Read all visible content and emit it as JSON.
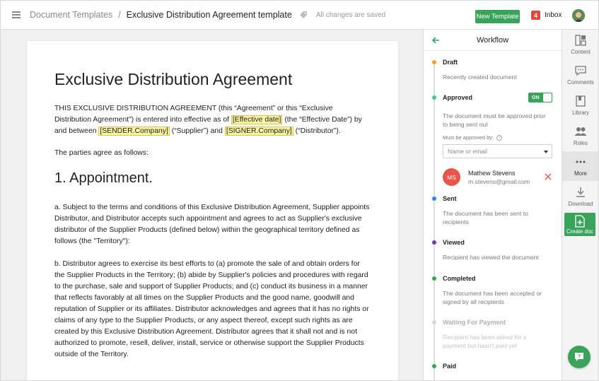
{
  "header": {
    "breadcrumb_root": "Document Templates",
    "breadcrumb_sep": "/",
    "document_name": "Exclusive Distribution Agreement template",
    "save_status": "All changes are saved",
    "new_template_label": "New Template",
    "inbox_count": "4",
    "inbox_label": "Inbox"
  },
  "document": {
    "title": "Exclusive Distribution Agreement",
    "intro": {
      "t1": "THIS EXCLUSIVE DISTRIBUTION AGREEMENT (this “Agreement” or this “Exclusive Distribution Agreement”) is entered into effective as of ",
      "f1": "[Effective date]",
      "t2": " (the “Effective Date”) by and between ",
      "f2": "[SENDER.Company]",
      "t3": " (“Supplier”) and ",
      "f3": "[SIGNER.Company]",
      "t4": " (“Distributor”)."
    },
    "parties": "The parties agree as follows:",
    "section_heading": "1. Appointment.",
    "para_a": "a. Subject to the terms and conditions of this Exclusive Distribution Agreement, Supplier appoints Distributor, and Distributor accepts such appointment and agrees to act as Supplier's exclusive distributor of the Supplier Products (defined below) within the geographical territory defined as follows (the \"Territory\"):",
    "para_b": "b. Distributor agrees to exercise its best efforts to (a) promote the sale of and obtain orders for the Supplier Products in the Territory; (b) abide by Supplier's policies and procedures with regard to the purchase, sale and support of Supplier Products; and (c) conduct its business in a manner that reflects favorably at all times on the Supplier Products and the good name, goodwill and reputation of Supplier or its affiliates. Distributor acknowledges and agrees that it has no rights or claims of any type to the Supplier Products, or any aspect thereof, except such rights as are created by this Exclusive Distribution Agreement. Distributor agrees that it shall not and is not authorized to promote, resell, deliver, install, service or otherwise support the Supplier Products outside of the Territory."
  },
  "workflow": {
    "title": "Workflow",
    "steps": [
      {
        "name": "Draft",
        "desc": "Recently created document",
        "color": "#f0a030"
      },
      {
        "name": "Approved",
        "desc": "The document must be approved prior to being sent out",
        "color": "#3ec7a0",
        "toggle": "ON"
      },
      {
        "name": "Sent",
        "desc": "The document has been sent to recipients",
        "color": "#2f86e0"
      },
      {
        "name": "Viewed",
        "desc": "Recipient has viewed the document",
        "color": "#6a3fb5"
      },
      {
        "name": "Completed",
        "desc": "The document has been accepted or signed by all recipients",
        "color": "#3aa35b"
      },
      {
        "name": "Waiting For Payment",
        "desc": "Recipient has been asked for a payment but hasn't paid yet",
        "color": "#d6d6d6"
      },
      {
        "name": "Paid",
        "desc": "",
        "color": "#3aa35b"
      }
    ],
    "must_be_approved_label": "Must be approved by:",
    "approver_placeholder": "Name or email",
    "approver": {
      "initials": "MS",
      "name": "Mathew Stevens",
      "email": "m.stevens@gmail.com"
    }
  },
  "sidebar": {
    "items": [
      {
        "label": "Content",
        "icon": "content-icon"
      },
      {
        "label": "Comments",
        "icon": "comments-icon"
      },
      {
        "label": "Library",
        "icon": "library-icon"
      },
      {
        "label": "Roles",
        "icon": "roles-icon"
      },
      {
        "label": "More",
        "icon": "more-icon"
      },
      {
        "label": "Download",
        "icon": "download-icon"
      }
    ],
    "create_doc_label": "Create doc"
  }
}
